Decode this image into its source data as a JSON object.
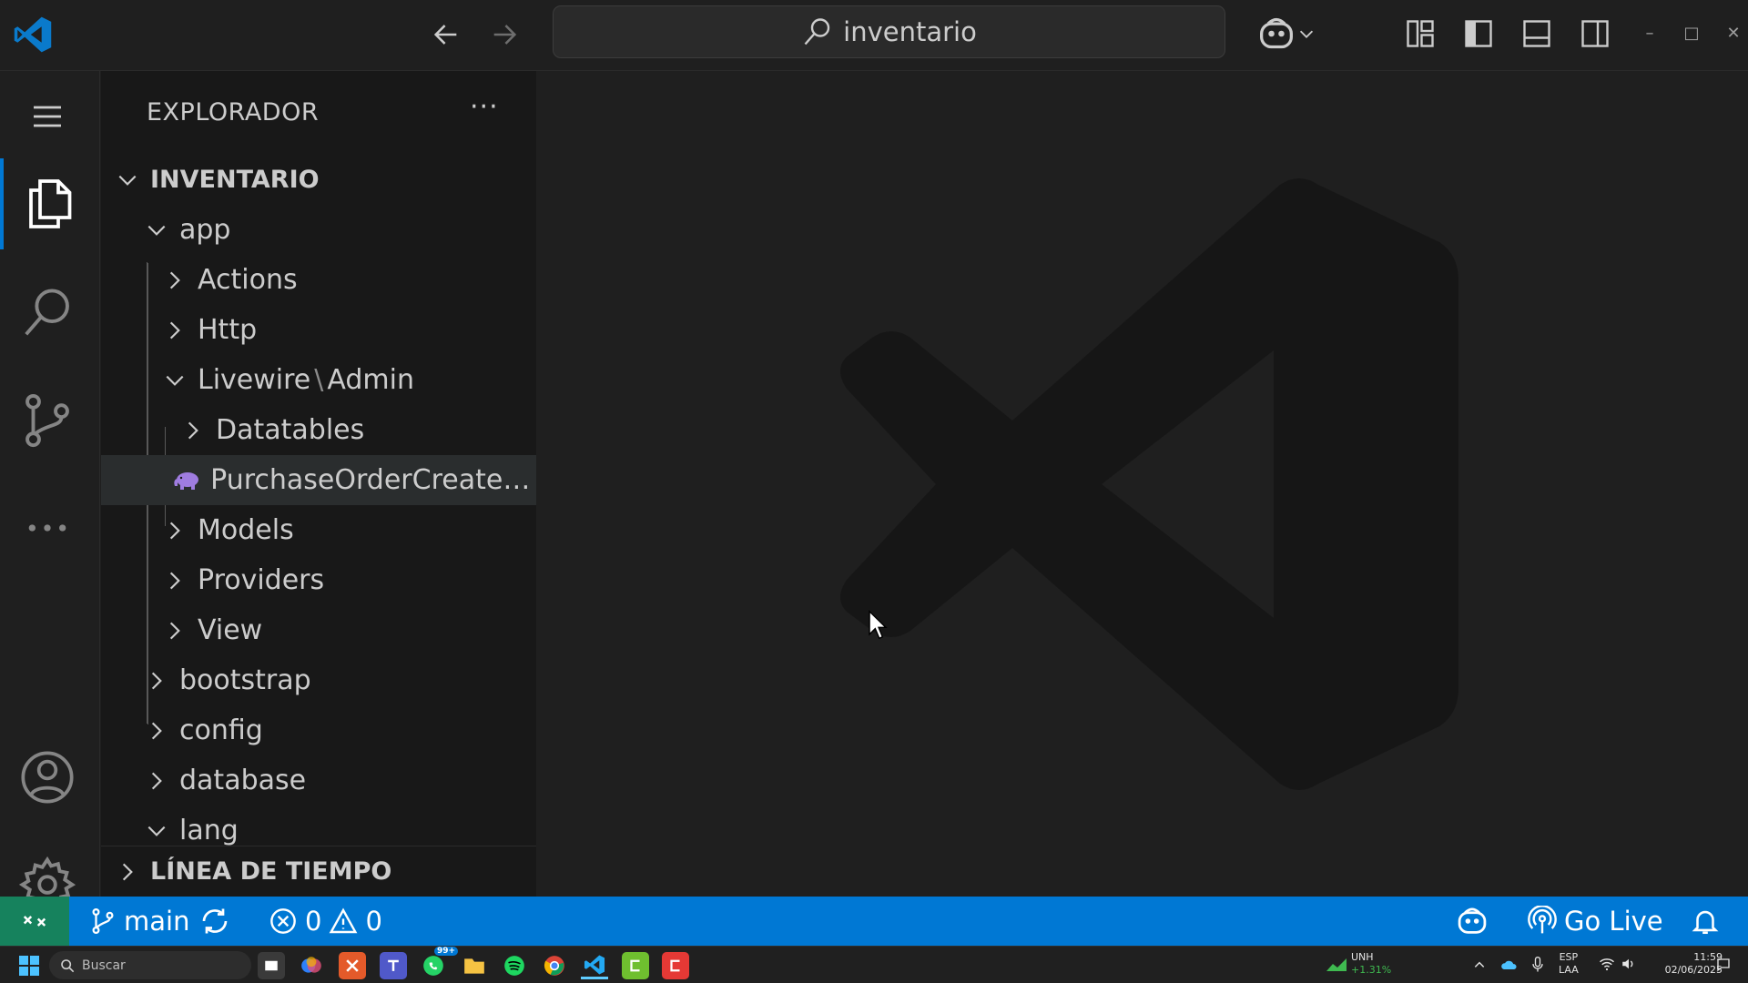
{
  "titlebar": {
    "search_text": "inventario",
    "window_controls": {
      "minimize": "–",
      "maximize": "□",
      "close": "✕"
    }
  },
  "sidebar": {
    "header": "EXPLORADOR",
    "more": "···",
    "root": "INVENTARIO",
    "tree": [
      {
        "label": "app",
        "expanded": true
      },
      {
        "label": "Actions",
        "expanded": false
      },
      {
        "label": "Http",
        "expanded": false
      },
      {
        "label_a": "Livewire",
        "label_sep": "\\",
        "label_b": "Admin",
        "expanded": true
      },
      {
        "label": "Datatables",
        "expanded": false
      },
      {
        "label": "PurchaseOrderCreate.p...",
        "selected": true,
        "icon": "php-elephant-icon"
      },
      {
        "label": "Models",
        "expanded": false
      },
      {
        "label": "Providers",
        "expanded": false
      },
      {
        "label": "View",
        "expanded": false
      },
      {
        "label": "bootstrap",
        "expanded": false
      },
      {
        "label": "config",
        "expanded": false
      },
      {
        "label": "database",
        "expanded": false
      },
      {
        "label": "lang",
        "expanded": true
      }
    ],
    "timeline": "LÍNEA DE TIEMPO"
  },
  "statusbar": {
    "branch": "main",
    "errors": "0",
    "warnings": "0",
    "go_live": "Go Live"
  },
  "taskbar": {
    "search_placeholder": "Buscar",
    "badge_whatsapp": "99+",
    "stock_symbol": "UNH",
    "stock_change": "+1.31%",
    "lang_line1": "ESP",
    "lang_line2": "LAA",
    "time": "11:59",
    "date": "02/06/2025"
  },
  "colors": {
    "accent": "#0078d4",
    "remote": "#16825d",
    "background": "#1f1f1f",
    "sidebar": "#181818"
  }
}
